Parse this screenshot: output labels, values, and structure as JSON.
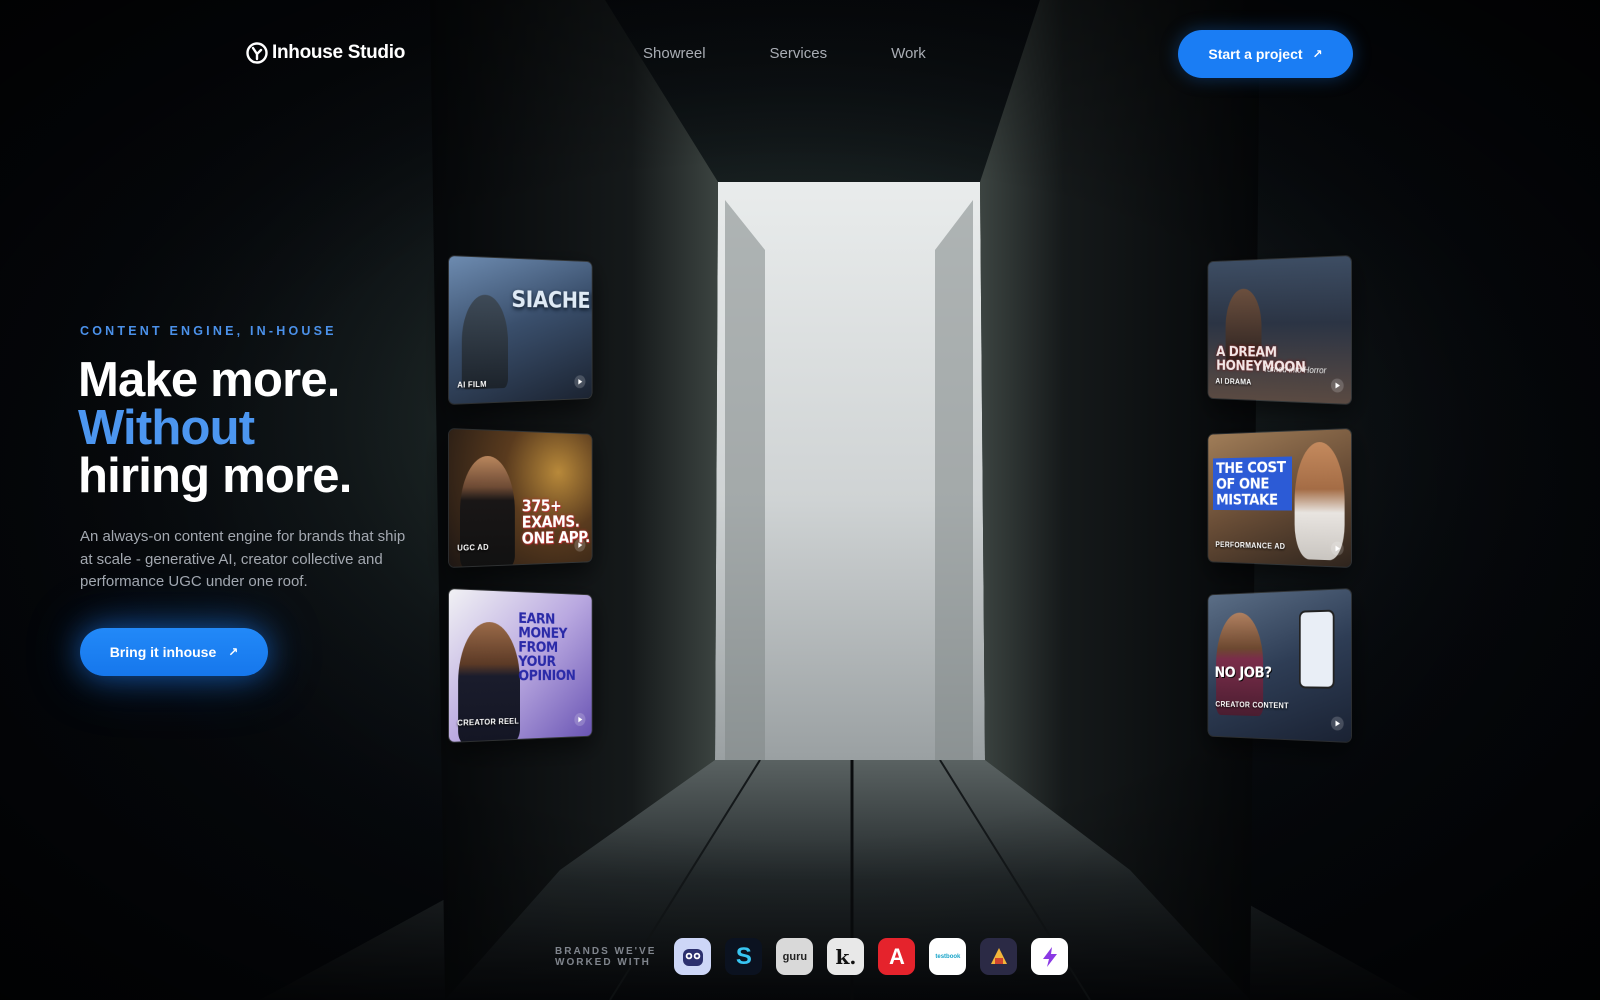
{
  "nav": {
    "logo_text": "Inhouse Studio",
    "links": [
      "Showreel",
      "Services",
      "Work"
    ],
    "cta_label": "Start a project",
    "cta_icon": "arrow-up-right-icon"
  },
  "hero": {
    "eyebrow": "CONTENT ENGINE, IN-HOUSE",
    "headline_line1": "Make more.",
    "headline_line2": "Without",
    "headline_line3": "hiring more.",
    "subcopy": "An always-on content engine for brands that ship at scale - generative AI, creator collective and performance UGC under one roof.",
    "cta_label": "Bring it inhouse",
    "cta_icon": "arrow-up-right-icon"
  },
  "cards": {
    "left": [
      {
        "title": "SIACHEN",
        "tag": "AI FILM"
      },
      {
        "title": "375+ EXAMS. ONE APP.",
        "tag": "UGC AD"
      },
      {
        "title": "EARN MONEY FROM YOUR OPINION",
        "tag": "CREATOR REEL"
      }
    ],
    "right": [
      {
        "title": "A DREAM HONEYMOON",
        "subtitle": "Turned into Horror",
        "tag": "AI DRAMA"
      },
      {
        "title": "THE COST OF ONE MISTAKE",
        "tag": "PERFORMANCE AD"
      },
      {
        "title": "NO JOB?",
        "tag": "CREATOR CONTENT"
      }
    ]
  },
  "brands": {
    "label_line1": "BRANDS WE'VE",
    "label_line2": "WORKED WITH",
    "logos": [
      {
        "name": "owl-logo",
        "text": "",
        "bg": "#cdd6f7",
        "fg": "#2b2f6e"
      },
      {
        "name": "s-logo",
        "text": "S",
        "bg": "#0b1220",
        "fg": "#38c5f2"
      },
      {
        "name": "guru-logo",
        "text": "guru",
        "bg": "#d9d9d9",
        "fg": "#222"
      },
      {
        "name": "k-logo",
        "text": "k.",
        "bg": "#e8e8e8",
        "fg": "#111"
      },
      {
        "name": "a-logo",
        "text": "A",
        "bg": "#e5232c",
        "fg": "#fff"
      },
      {
        "name": "testbook-logo",
        "text": "testbook",
        "bg": "#ffffff",
        "fg": "#16a3c8"
      },
      {
        "name": "game-logo",
        "text": "",
        "bg": "#2b2a45",
        "fg": "#f3b63a"
      },
      {
        "name": "bolt-logo",
        "text": "",
        "bg": "#ffffff",
        "fg": "#8a39e4"
      }
    ]
  }
}
